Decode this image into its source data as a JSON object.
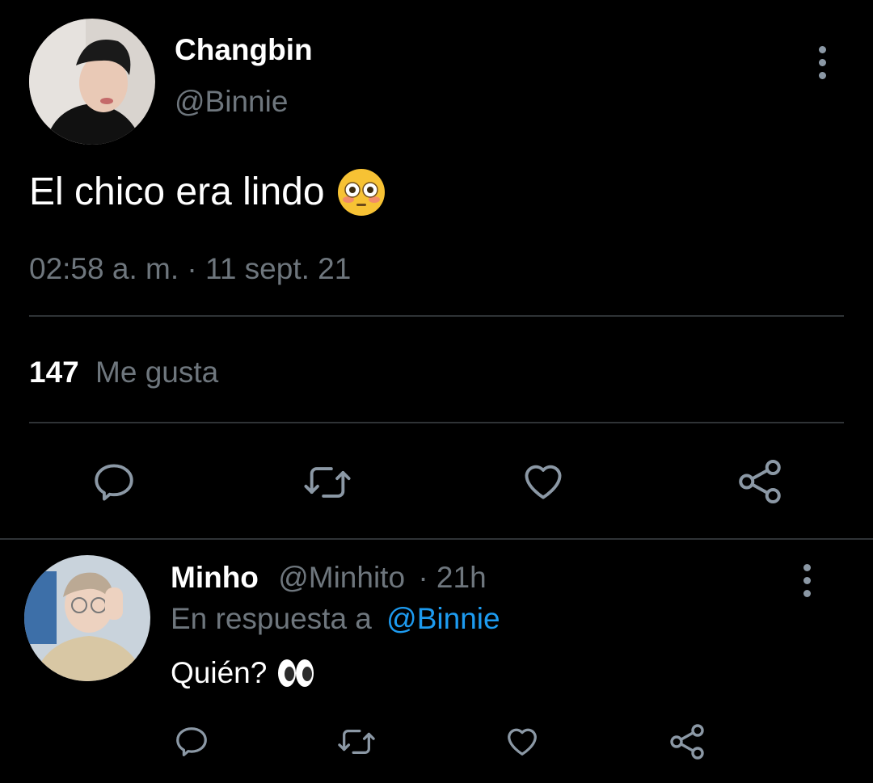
{
  "tweet": {
    "author_name": "Changbin",
    "author_handle": "@Binnie",
    "text": "El chico era lindo",
    "text_emoji": "flushed-face",
    "timestamp": "02:58 a. m. · 11 sept. 21",
    "likes_count": "147",
    "likes_label": "Me gusta",
    "actions": [
      "reply-icon",
      "retweet-icon",
      "like-icon",
      "share-icon"
    ]
  },
  "reply": {
    "author_name": "Minho",
    "author_handle": "@Minhito",
    "age": "· 21h",
    "in_reply_prefix": "En respuesta a",
    "in_reply_handle": "@Binnie",
    "text": "Quién?",
    "text_emoji": "eyes",
    "actions": [
      "reply-icon",
      "retweet-icon",
      "like-icon",
      "share-icon"
    ]
  },
  "colors": {
    "background": "#000000",
    "primary_text": "#ffffff",
    "secondary_text": "#6e767d",
    "link": "#1d9bf0",
    "divider": "#2f3336",
    "icon": "#8b98a5"
  }
}
